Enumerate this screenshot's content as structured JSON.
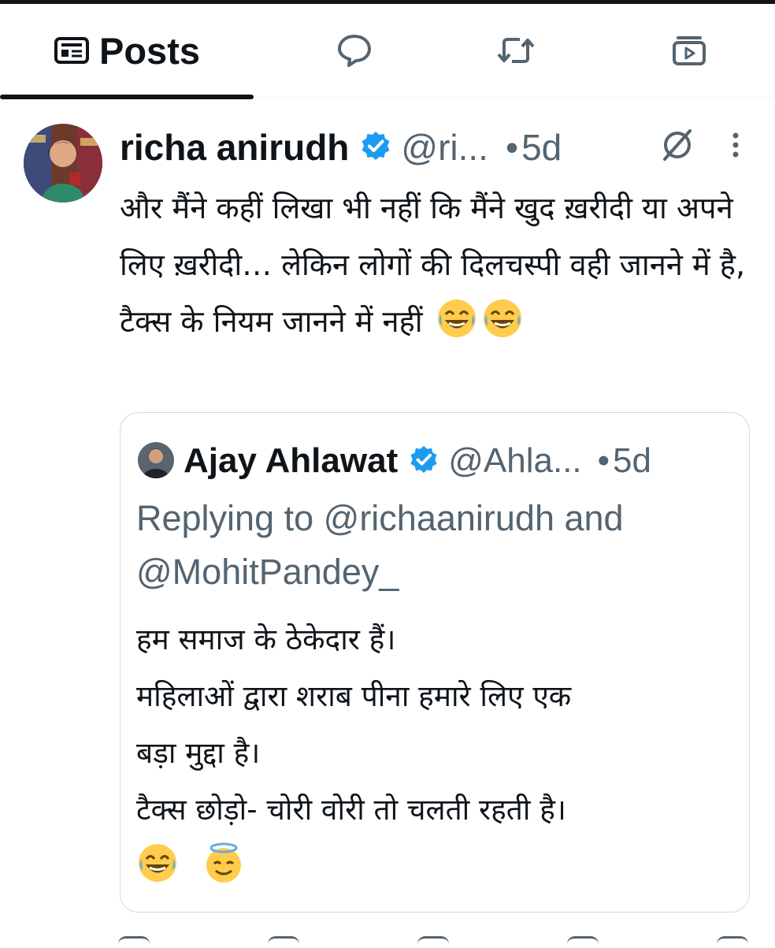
{
  "tabs": {
    "posts_label": "Posts",
    "icons": [
      "posts-icon",
      "replies-icon",
      "reposts-icon",
      "media-icon"
    ]
  },
  "post": {
    "display_name": "richa anirudh",
    "handle": "@ri...",
    "dot": "•",
    "time": "5d",
    "text": "और मैंने कहीं लिखा भी नहीं कि मैंने खुद ख़रीदी या अपने लिए ख़रीदी… लेकिन लोगों की दिलचस्पी वही जानने में है, टैक्स के नियम जानने में नहीं",
    "emojis": [
      "😂",
      "😂"
    ],
    "accent_color": "#1d9bf0"
  },
  "quote": {
    "display_name": "Ajay Ahlawat",
    "handle": "@Ahla...",
    "dot": "•",
    "time": "5d",
    "replying_to": "Replying to @richaanirudh and @MohitPandey_",
    "lines": [
      "हम समाज के ठेकेदार हैं।",
      "महिलाओं द्वारा शराब पीना हमारे लिए एक",
      "बड़ा मुद्दा है।",
      "टैक्स छोड़ो- चोरी वोरी तो चलती रहती है।"
    ],
    "emojis": [
      "😂",
      "😇"
    ]
  }
}
